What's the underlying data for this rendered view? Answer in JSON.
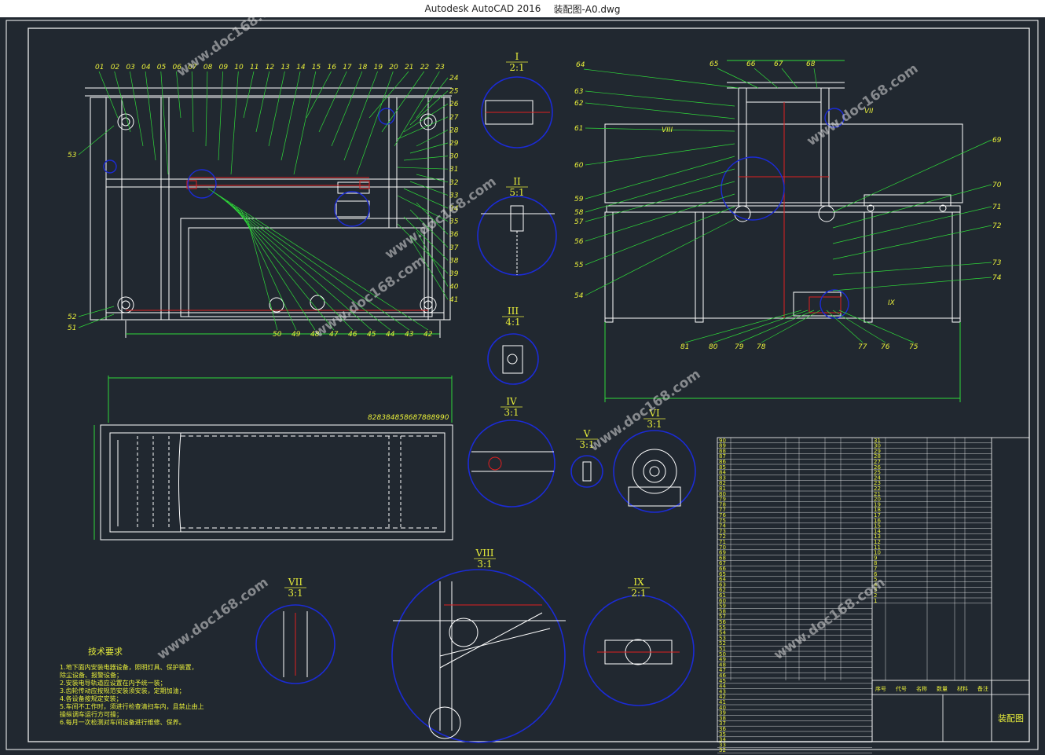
{
  "app": {
    "title": "Autodesk AutoCAD 2016",
    "document": "装配图-A0.dwg"
  },
  "colors": {
    "background": "#212830",
    "frame": "#ffffff",
    "leader": "#2fd93a",
    "label": "#e8ee3a",
    "detail_circle": "#1b2bd6",
    "accent_red": "#e02020"
  },
  "watermark": "www.doc168.com",
  "front_view": {
    "top_labels": [
      "01",
      "02",
      "03",
      "04",
      "05",
      "06",
      "07",
      "08",
      "09",
      "10",
      "11",
      "12",
      "13",
      "14",
      "15",
      "16",
      "17",
      "18",
      "19",
      "20",
      "21",
      "22",
      "23"
    ],
    "right_labels": [
      "24",
      "25",
      "26",
      "27",
      "28",
      "29",
      "30",
      "31",
      "32",
      "33",
      "34",
      "35",
      "36",
      "37",
      "38",
      "39",
      "40",
      "41"
    ],
    "bottom_labels": [
      "42",
      "43",
      "44",
      "45",
      "46",
      "47",
      "48",
      "49",
      "50"
    ],
    "left_labels": [
      "53",
      "52",
      "51"
    ]
  },
  "side_view": {
    "top_labels": [
      "64",
      "65",
      "66",
      "67",
      "68"
    ],
    "left_labels": [
      "63",
      "62",
      "61",
      "60",
      "59",
      "58",
      "57",
      "56",
      "55",
      "54"
    ],
    "right_labels": [
      "69",
      "70",
      "71",
      "72",
      "73",
      "74"
    ],
    "bottom_labels": [
      "81",
      "80",
      "79",
      "78",
      "77",
      "76",
      "75"
    ],
    "markers": [
      "VIII",
      "VII",
      "IX"
    ]
  },
  "plan_view": {
    "labels": [
      "82",
      "83",
      "84",
      "85",
      "86",
      "87",
      "88",
      "89",
      "90"
    ]
  },
  "details": [
    {
      "roman": "I",
      "scale": "2:1"
    },
    {
      "roman": "II",
      "scale": "5:1"
    },
    {
      "roman": "III",
      "scale": "4:1"
    },
    {
      "roman": "IV",
      "scale": "3:1"
    },
    {
      "roman": "V",
      "scale": "3:1"
    },
    {
      "roman": "VI",
      "scale": "3:1"
    },
    {
      "roman": "VII",
      "scale": "3:1"
    },
    {
      "roman": "VIII",
      "scale": "3:1"
    },
    {
      "roman": "IX",
      "scale": "2:1"
    }
  ],
  "tech_notes": {
    "title": "技术要求",
    "lines": [
      "1.地下面内安装电器设备，照明灯具、保护装置，",
      "除尘设备、报警设备；",
      "2.安装电导轨道应设置在内予统一装；",
      "3.齿轮传动应按规范安装须安装，定期加油；",
      "4.各设备按规定安装；",
      "5.车间不工作时，须进行检查清扫车内，且禁止由上",
      "操纵调车运行方可操；",
      "6.每月一次检测对车间设备进行维修、保养。"
    ]
  },
  "title_block": {
    "title": "装配图",
    "header": [
      "序号",
      "代号",
      "名称",
      "数量",
      "材料",
      "备注"
    ],
    "left_rows": [
      "90",
      "89",
      "88",
      "87",
      "86",
      "85",
      "84",
      "83",
      "82",
      "81",
      "80",
      "79",
      "78",
      "77",
      "76",
      "75",
      "74",
      "73",
      "72",
      "71",
      "70",
      "69",
      "68",
      "67",
      "66",
      "65",
      "64",
      "63",
      "62",
      "61",
      "60",
      "59",
      "58",
      "57",
      "56",
      "55",
      "54",
      "53",
      "52",
      "51",
      "50",
      "49",
      "48",
      "47",
      "46",
      "45",
      "44",
      "43",
      "42",
      "41",
      "40",
      "39",
      "38",
      "37",
      "36",
      "35",
      "34",
      "33",
      "32"
    ],
    "right_rows": [
      "31",
      "30",
      "29",
      "28",
      "27",
      "26",
      "25",
      "24",
      "23",
      "22",
      "21",
      "20",
      "19",
      "18",
      "17",
      "16",
      "15",
      "14",
      "13",
      "12",
      "11",
      "10",
      "9",
      "8",
      "7",
      "6",
      "5",
      "4",
      "3",
      "2",
      "1"
    ]
  }
}
